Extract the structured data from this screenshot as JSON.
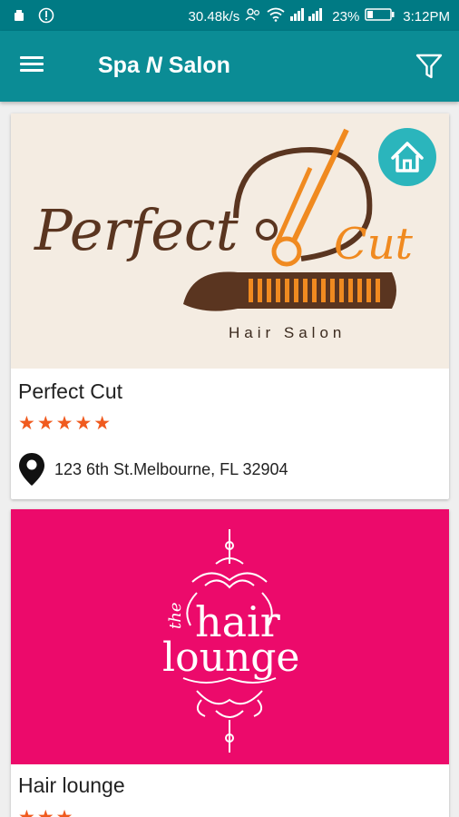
{
  "status_bar": {
    "speed": "30.48k/s",
    "battery": "23%",
    "time": "3:12PM"
  },
  "app_bar": {
    "title_part1": "Spa ",
    "title_n": "N",
    "title_part2": " Salon"
  },
  "listings": [
    {
      "name": "Perfect Cut",
      "rating": 5,
      "stars": "★★★★★",
      "address": "123 6th St.Melbourne, FL 32904",
      "logo": {
        "script_text": "Perfect",
        "accent_text": "Cut",
        "tagline": "Hair  Salon"
      }
    },
    {
      "name": "Hair lounge",
      "stars": "★★★",
      "logo": {
        "line1": "the",
        "line2": "hair",
        "line3": "lounge"
      }
    }
  ],
  "colors": {
    "status_bar": "#007a84",
    "app_bar": "#0b8c95",
    "star": "#f05a1e",
    "home_badge": "#2bb5bc",
    "hair_lounge_bg": "#ec0a6b"
  }
}
